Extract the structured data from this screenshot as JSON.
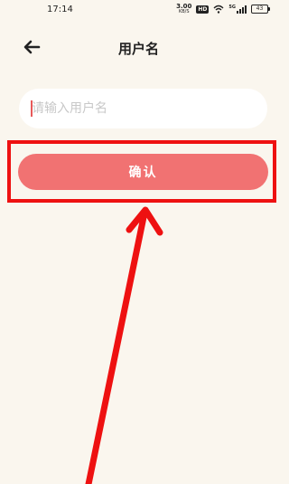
{
  "status_bar": {
    "time": "17:14",
    "net_speed_value": "3.00",
    "net_speed_unit": "KB/S",
    "hd_label": "HD",
    "signal_label": "5G",
    "battery_level": "43"
  },
  "header": {
    "title": "用户名",
    "back_icon": "arrow-left-icon"
  },
  "form": {
    "username_value": "",
    "username_placeholder": "请输入用户名",
    "confirm_label": "确认"
  },
  "annotation": {
    "highlight_color": "#ee1111",
    "arrow_color": "#ee1111"
  },
  "colors": {
    "background": "#faf6ee",
    "button": "#f17272",
    "input_background": "#ffffff"
  }
}
